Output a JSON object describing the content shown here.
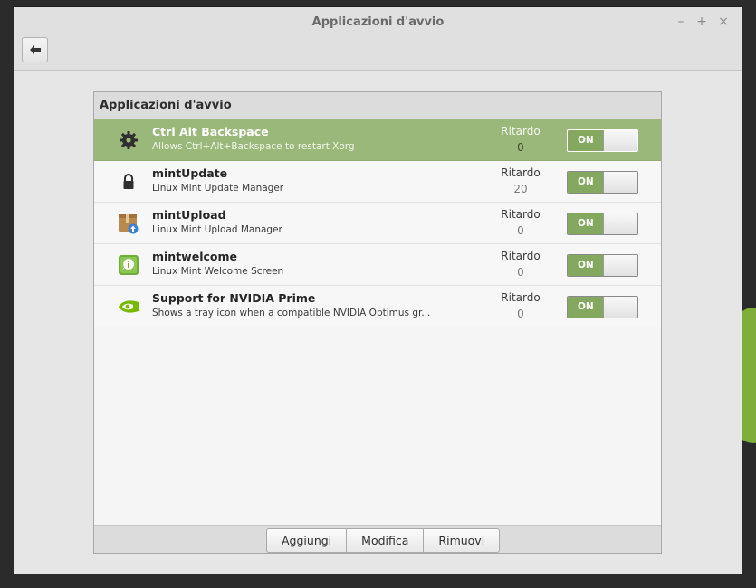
{
  "window": {
    "title": "Applicazioni d'avvio",
    "controls": {
      "minimize": "–",
      "maximize": "+",
      "close": "×"
    }
  },
  "panel": {
    "title": "Applicazioni d'avvio"
  },
  "apps": [
    {
      "name": "Ctrl Alt Backspace",
      "desc": "Allows Ctrl+Alt+Backspace to restart Xorg",
      "delay_label": "Ritardo",
      "delay": "0",
      "switch": "ON",
      "icon": "gear-icon",
      "selected": true
    },
    {
      "name": "mintUpdate",
      "desc": "Linux Mint Update Manager",
      "delay_label": "Ritardo",
      "delay": "20",
      "switch": "ON",
      "icon": "lock-icon",
      "selected": false
    },
    {
      "name": "mintUpload",
      "desc": "Linux Mint Upload Manager",
      "delay_label": "Ritardo",
      "delay": "0",
      "switch": "ON",
      "icon": "upload-box-icon",
      "selected": false
    },
    {
      "name": "mintwelcome",
      "desc": "Linux Mint Welcome Screen",
      "delay_label": "Ritardo",
      "delay": "0",
      "switch": "ON",
      "icon": "welcome-info-icon",
      "selected": false
    },
    {
      "name": "Support for NVIDIA Prime",
      "desc": "Shows a tray icon when a compatible NVIDIA Optimus gr...",
      "delay_label": "Ritardo",
      "delay": "0",
      "switch": "ON",
      "icon": "nvidia-icon",
      "selected": false
    }
  ],
  "toolbar": {
    "add_label": "Aggiungi",
    "edit_label": "Modifica",
    "remove_label": "Rimuovi"
  },
  "colors": {
    "selection": "#9ab87a",
    "switch_on": "#85a860",
    "desktop_accent": "#7fae3a"
  }
}
